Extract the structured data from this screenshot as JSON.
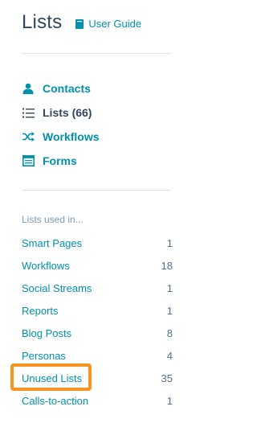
{
  "header": {
    "title": "Lists",
    "guide_label": "User Guide"
  },
  "nav": [
    {
      "label": "Contacts",
      "icon": "person-icon",
      "active": false
    },
    {
      "label": "Lists (66)",
      "icon": "list-icon",
      "active": true
    },
    {
      "label": "Workflows",
      "icon": "shuffle-icon",
      "active": false
    },
    {
      "label": "Forms",
      "icon": "form-icon",
      "active": false
    }
  ],
  "lists_used_in": {
    "heading": "Lists used in...",
    "items": [
      {
        "label": "Smart Pages",
        "count": "1"
      },
      {
        "label": "Workflows",
        "count": "18"
      },
      {
        "label": "Social Streams",
        "count": "1"
      },
      {
        "label": "Reports",
        "count": "1"
      },
      {
        "label": "Blog Posts",
        "count": "8"
      },
      {
        "label": "Personas",
        "count": "4"
      },
      {
        "label": "Unused Lists",
        "count": "35",
        "highlighted": true
      },
      {
        "label": "Calls-to-action",
        "count": "1"
      }
    ]
  },
  "colors": {
    "link": "#0091ae",
    "text_dark": "#33475b",
    "highlight": "#f7931e"
  }
}
